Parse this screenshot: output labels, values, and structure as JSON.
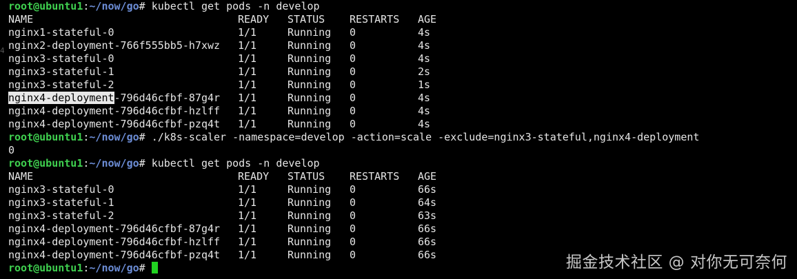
{
  "prompt": {
    "user": "root@ubuntu1",
    "sep": ":",
    "path": "~/now/go",
    "sym": "#"
  },
  "commands": {
    "get_pods": "kubectl get pods -n develop",
    "scaler": "./k8s-scaler -namespace=develop -action=scale -exclude=nginx3-stateful,nginx4-deployment"
  },
  "scaler_output": "0",
  "side_marker": "4",
  "headers": {
    "name": "NAME",
    "ready": "READY",
    "status": "STATUS",
    "restarts": "RESTARTS",
    "age": "AGE"
  },
  "table1": [
    {
      "name": "nginx1-stateful-0",
      "ready": "1/1",
      "status": "Running",
      "restarts": "0",
      "age": "4s"
    },
    {
      "name": "nginx2-deployment-766f555bb5-h7xwz",
      "ready": "1/1",
      "status": "Running",
      "restarts": "0",
      "age": "4s"
    },
    {
      "name": "nginx3-stateful-0",
      "ready": "1/1",
      "status": "Running",
      "restarts": "0",
      "age": "4s"
    },
    {
      "name": "nginx3-stateful-1",
      "ready": "1/1",
      "status": "Running",
      "restarts": "0",
      "age": "2s"
    },
    {
      "name": "nginx3-stateful-2",
      "ready": "1/1",
      "status": "Running",
      "restarts": "0",
      "age": "1s"
    },
    {
      "name_hl": "nginx4-deployment",
      "name_rest": "-796d46cfbf-87g4r",
      "ready": "1/1",
      "status": "Running",
      "restarts": "0",
      "age": "4s"
    },
    {
      "name": "nginx4-deployment-796d46cfbf-hzlff",
      "ready": "1/1",
      "status": "Running",
      "restarts": "0",
      "age": "4s"
    },
    {
      "name": "nginx4-deployment-796d46cfbf-pzq4t",
      "ready": "1/1",
      "status": "Running",
      "restarts": "0",
      "age": "4s"
    }
  ],
  "table2": [
    {
      "name": "nginx3-stateful-0",
      "ready": "1/1",
      "status": "Running",
      "restarts": "0",
      "age": "66s"
    },
    {
      "name": "nginx3-stateful-1",
      "ready": "1/1",
      "status": "Running",
      "restarts": "0",
      "age": "64s"
    },
    {
      "name": "nginx3-stateful-2",
      "ready": "1/1",
      "status": "Running",
      "restarts": "0",
      "age": "63s"
    },
    {
      "name": "nginx4-deployment-796d46cfbf-87g4r",
      "ready": "1/1",
      "status": "Running",
      "restarts": "0",
      "age": "66s"
    },
    {
      "name": "nginx4-deployment-796d46cfbf-hzlff",
      "ready": "1/1",
      "status": "Running",
      "restarts": "0",
      "age": "66s"
    },
    {
      "name": "nginx4-deployment-796d46cfbf-pzq4t",
      "ready": "1/1",
      "status": "Running",
      "restarts": "0",
      "age": "66s"
    }
  ],
  "watermark": "掘金技术社区 @ 对你无可奈何",
  "colors": {
    "prompt_user": "#3fd04f",
    "prompt_path": "#6c8dd6",
    "cursor": "#21d321",
    "background": "#000000"
  }
}
